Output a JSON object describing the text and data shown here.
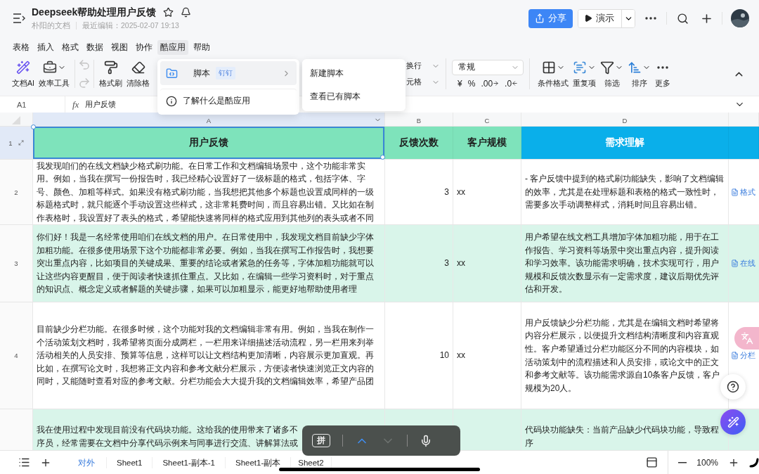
{
  "header": {
    "title": "Deepseek帮助处理用户反馈",
    "owner": "朴阳的文档",
    "edited": "最近编辑：2025-02-07 19:13",
    "share": "分享",
    "present": "演示"
  },
  "menu": [
    {
      "label": "表格",
      "selected": false
    },
    {
      "label": "插入",
      "selected": false
    },
    {
      "label": "格式",
      "selected": false
    },
    {
      "label": "数据",
      "selected": false
    },
    {
      "label": "视图",
      "selected": false
    },
    {
      "label": "协作",
      "selected": false
    },
    {
      "label": "酷应用",
      "selected": true
    },
    {
      "label": "帮助",
      "selected": false
    }
  ],
  "toolbar": {
    "left": [
      {
        "kind": "ai",
        "label": "文档AI"
      },
      {
        "kind": "tools",
        "label": "效率工具"
      }
    ],
    "history": {
      "disabled": true
    },
    "format": [
      {
        "kind": "brush",
        "label": "格式刷"
      },
      {
        "kind": "eraser",
        "label": "清除格"
      }
    ],
    "wrap": [
      "换行",
      "元格"
    ],
    "number": {
      "value": "常规",
      "buttons": [
        {
          "kind": "plain",
          "label": "¥"
        },
        {
          "kind": "plain",
          "label": "%"
        },
        {
          "kind": "increase",
          "label": ".00"
        },
        {
          "kind": "decrease",
          "label": ".0"
        }
      ]
    },
    "right": [
      {
        "kind": "conditional",
        "label": "条件格式"
      },
      {
        "kind": "duplicate",
        "label": "重复项"
      },
      {
        "kind": "filter",
        "label": "筛选"
      },
      {
        "kind": "sort",
        "label": "排序"
      },
      {
        "kind": "more",
        "label": "更多"
      }
    ]
  },
  "app_menu": {
    "items": [
      {
        "kind": "script",
        "label": "脚本",
        "badge": "钉钉",
        "selected": true
      },
      {
        "kind": "info",
        "label": "了解什么是酷应用",
        "selected": false
      }
    ],
    "submenu": [
      "新建脚本",
      "查看已有脚本"
    ]
  },
  "formula_bar": {
    "cell": "A1",
    "fx": "fx",
    "value": "用户反馈"
  },
  "columns": [
    {
      "label": "A",
      "selected": true
    },
    {
      "label": "B",
      "selected": false
    },
    {
      "label": "C",
      "selected": false
    },
    {
      "label": "D",
      "selected": false
    }
  ],
  "header_row": {
    "number": "1",
    "selected": true,
    "cells": [
      {
        "text": "用户反馈",
        "color": "#7ee3bb"
      },
      {
        "text": "反馈次数",
        "color": "#7ee3bb"
      },
      {
        "text": "客户规模",
        "color": "#7ee3bb"
      },
      {
        "text": "需求理解",
        "color": "#0aafea"
      },
      {
        "color": "#0aafea"
      }
    ]
  },
  "rows": [
    {
      "number": "2",
      "shaded": false,
      "feedback": "我发现咱们的在线文档缺少格式刷功能。在日常工作和文档编辑场景中，这个功能非常实用。例如，当我在撰写一份报告时，我已经精心设置好了一级标题的格式，包括字体、字号、颜色、加粗等样式。如果没有格式刷功能，当我想把其他多个标题也设置成同样的一级标题格式时，就只能逐个手动设置这些样式，这非常耗费时间，而且容易出错。又比如在制作表格时，我设置好了表头的格式，希望能快速将同样的格式应用到其他列的表头或者不同",
      "count": "3",
      "scale": "xx",
      "understanding": "- 客户反馈中提到的格式刷功能缺失，影响了文档编辑的效率，尤其是在处理标题和表格的格式一致性时，需要多次手动调整样式，消耗时间且容易出错。",
      "column_5": "格式"
    },
    {
      "number": "3",
      "shaded": true,
      "feedback": "你们好！我是一名经常使用咱们在线文档的用户。在日常使用中，我发现文档目前缺少字体加粗功能。在很多使用场景下这个功能都非常必要。例如，当我在撰写工作报告时，我想要突出重点内容，比如项目的关键成果、重要的结论或者紧急的任务等，字体加粗功能就可以让这些内容更醒目，便于阅读者快速抓住重点。又比如，在编辑一些学习资料时，对于重点的知识点、概念定义或者解题的关键步骤，如果可以加粗显示，能更好地帮助使用者理",
      "count": "3",
      "scale": "xx",
      "understanding": "用户希望在线文档工具增加字体加粗功能，用于在工作报告、学习资料等场景中突出重点内容，提升阅读和学习效率。该功能需求明确，技术实现可行，用户规模和反馈次数显示有一定需求度，建议后期优先评估和开发。",
      "column_5": "在线"
    },
    {
      "number": "4",
      "shaded": false,
      "feedback": "目前缺少分栏功能。在很多时候，这个功能对我的文档编辑非常有用。例如，当我在制作一个活动策划文档时，我希望将页面分成两栏，一栏用来详细描述活动流程，另一栏用来列举活动相关的人员安排、预算等信息，这样可以让文档结构更加清晰，内容展示更加直观。再比如，在撰写论文时，我想将正文内容和参考文献分栏展示，方便读者快速浏览正文内容的同时，又能随时查看对应的参考文献。分栏功能会大大提升我的文档编辑效率，希望产品团",
      "count": "10",
      "scale": "xx",
      "understanding": "用户反馈缺少分栏功能，尤其是在编辑文档时希望将内容分栏展示，以便提升文档结构清晰度和内容直观性。客户希望通过分栏功能区分不同的内容模块，如活动策划中的流程描述和人员安排，或论文中的正文和参考文献等。该功能需求源自10条客户反馈，客户规模为20人。",
      "column_5": "分栏"
    },
    {
      "shaded": true,
      "feedback": [
        "我在使用过程中发现目前没有代码块功能。这给我的使用带来了诸多不",
        "序员，经常需要在文档中分享代码示例来与同事进行交流、讲解算法或"
      ],
      "understanding": "代码块功能缺失：当前产品缺少代码块功能，导致程序"
    }
  ],
  "sheets": [
    {
      "label": "对外",
      "selected": true
    },
    {
      "label": "Sheet1",
      "selected": false
    },
    {
      "label": "Sheet1-副本-1",
      "selected": false
    },
    {
      "label": "Sheet1-副本",
      "selected": false
    },
    {
      "label": "Sheet2",
      "selected": false
    }
  ],
  "zoom": "100%",
  "ime_bar": {
    "key": "拼"
  }
}
